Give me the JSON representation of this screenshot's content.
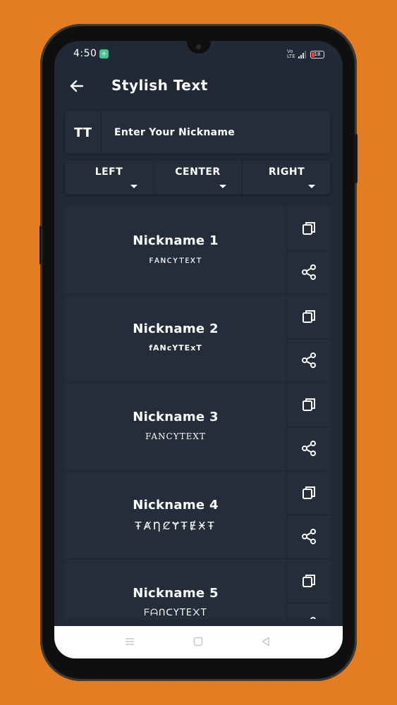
{
  "status": {
    "time": "4:50",
    "notif": "+",
    "volte": "Vo LTE",
    "battery": "18"
  },
  "header": {
    "title": "Stylish Text"
  },
  "input": {
    "icon_text": "TT",
    "placeholder": "Enter Your Nickname"
  },
  "alignment": {
    "left": "LEFT",
    "center": "CENTER",
    "right": "RIGHT"
  },
  "results": [
    {
      "title": "Nickname 1",
      "fancy": "ꜰᴀɴᴄʏᴛᴇxᴛ"
    },
    {
      "title": "Nickname 2",
      "fancy": "fANcYTExT"
    },
    {
      "title": "Nickname 3",
      "fancy": "FANCYTEXT"
    },
    {
      "title": "Nickname 4",
      "fancy": "ŦȺȠȻɎŦɆӾŦ"
    },
    {
      "title": "Nickname 5",
      "fancy": "ᖴᗩᑎᑕYTE᙭T"
    }
  ],
  "icons": {
    "back": "arrow-left-icon",
    "copy": "copy-icon",
    "share": "share-icon",
    "nav_menu": "menu-icon",
    "nav_home": "home-icon",
    "nav_back": "back-triangle-icon"
  },
  "colors": {
    "background": "#E47C22",
    "screen": "#212936",
    "card": "#252d3b"
  }
}
